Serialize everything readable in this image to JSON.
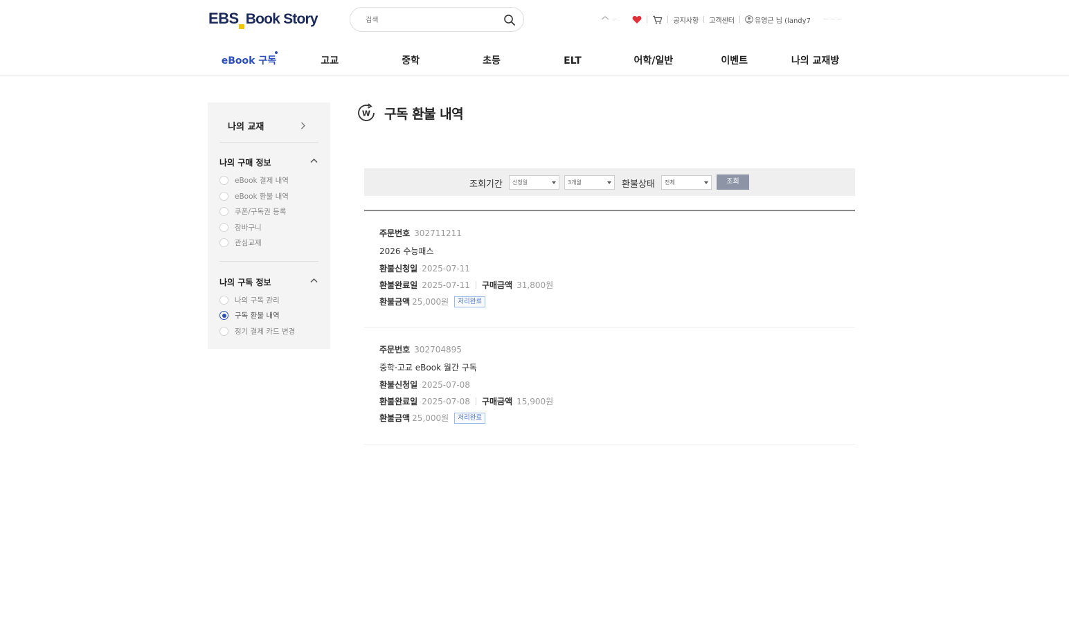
{
  "header": {
    "logo": {
      "ebs": "EBS",
      "bookstory": "Book Story"
    },
    "search": {
      "placeholder": "검색"
    },
    "util": {
      "faded_left": "ㅡ",
      "notice": "공지사항",
      "support": "고객센터",
      "user": "유영근 님 (landy7",
      "faded_right": "ㅡ ㅡ ㅡ"
    }
  },
  "gnb": {
    "items": [
      {
        "label": "eBook 구독"
      },
      {
        "label": "고교"
      },
      {
        "label": "중학"
      },
      {
        "label": "초등"
      },
      {
        "label": "ELT"
      },
      {
        "label": "어학/일반"
      },
      {
        "label": "이벤트"
      },
      {
        "label": "나의 교재방"
      }
    ]
  },
  "sidebar": {
    "my_books": "나의 교재",
    "purchase_section": "나의 구매 정보",
    "purchase_items": [
      {
        "label": "eBook 결제 내역"
      },
      {
        "label": "eBook 환불 내역"
      },
      {
        "label": "쿠폰/구독권 등록"
      },
      {
        "label": "장바구니"
      },
      {
        "label": "관심교재"
      }
    ],
    "subscription_section": "나의 구독 정보",
    "subscription_items": [
      {
        "label": "나의 구독 관리"
      },
      {
        "label": "구독 환불 내역",
        "selected": true
      },
      {
        "label": "정기 결제 카드 변경"
      }
    ]
  },
  "page": {
    "title": "구독 환불 내역",
    "title_icon_letter": "W"
  },
  "filter": {
    "period_label": "조회기간",
    "period_type": "신청일",
    "period_range": "3개월",
    "status_label": "환불상태",
    "status_value": "전체",
    "search_button": "조회"
  },
  "labels": {
    "order_no": "주문번호",
    "request_date": "환불신청일",
    "complete_date": "환불완료일",
    "purchase_amount": "구매금액",
    "refund_amount": "환불금액"
  },
  "orders": [
    {
      "order_no": "302711211",
      "product": "2026 수능패스",
      "request_date": "2025-07-11",
      "complete_date": "2025-07-11",
      "purchase_amount": "31,800원",
      "refund_amount": "25,000원",
      "status": "처리완료"
    },
    {
      "order_no": "302704895",
      "product": "중학·고교 eBook 월간 구독",
      "request_date": "2025-07-08",
      "complete_date": "2025-07-08",
      "purchase_amount": "15,900원",
      "refund_amount": "25,000원",
      "status": "처리완료"
    }
  ],
  "colors": {
    "accent": "#2a4fb8",
    "logo": "#1b2a5a",
    "logo_mark": "#f3c400",
    "heart": "#e0303a",
    "search_button": "#8c94a6"
  }
}
